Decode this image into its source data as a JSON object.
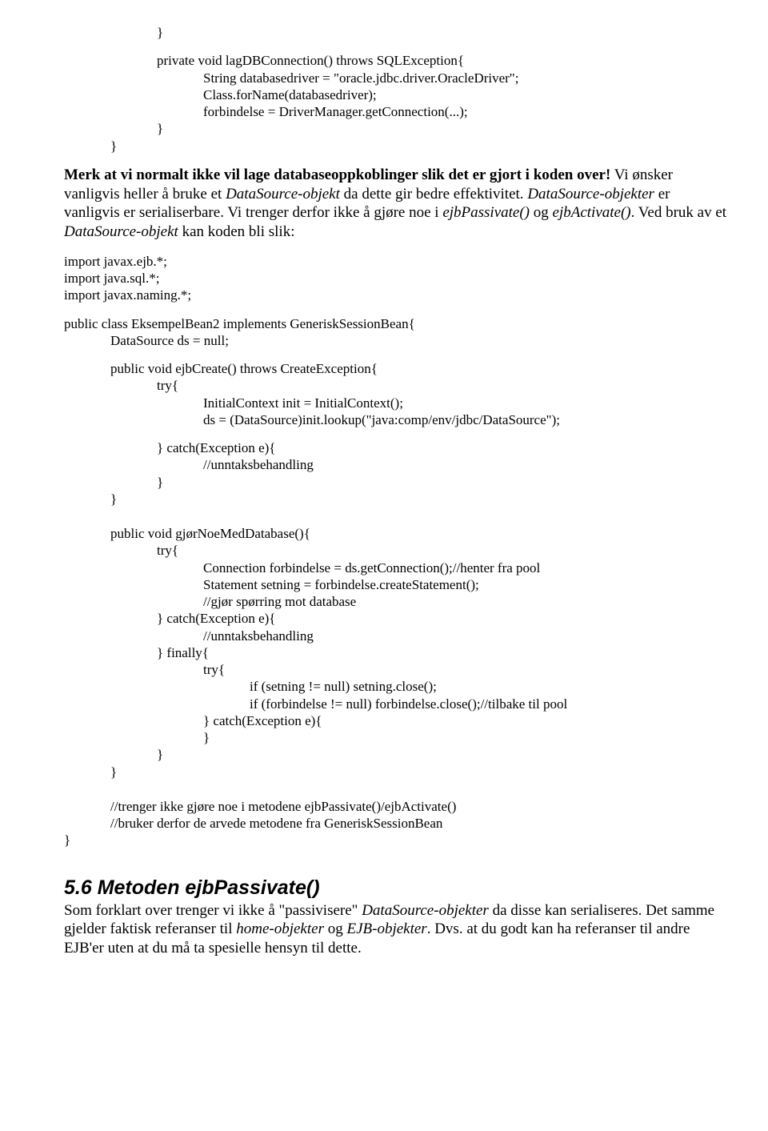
{
  "block1": {
    "l1": "}",
    "l2": "private void lagDBConnection() throws SQLException{",
    "l3": "String databasedriver = \"oracle.jdbc.driver.OracleDriver\";",
    "l4": "Class.forName(databasedriver);",
    "l5": "forbindelse = DriverManager.getConnection(...);",
    "l6": "}",
    "l7": "}"
  },
  "para1": {
    "t1": "Merk at vi normalt ikke vil lage databaseoppkoblinger slik det er gjort i koden over!",
    "t2": " Vi ønsker vanligvis heller å bruke et ",
    "t3": "DataSource-objekt",
    "t4": " da dette gir bedre effektivitet. ",
    "t5": "DataSource-objekter",
    "t6": " er vanligvis er serialiserbare. Vi trenger derfor ikke å gjøre noe i ",
    "t7": "ejbPassivate()",
    "t8": " og ",
    "t9": "ejbActivate()",
    "t10": ". Ved bruk av et ",
    "t11": "DataSource-objekt",
    "t12": " kan koden bli slik:"
  },
  "block2": {
    "l1": "import javax.ejb.*;",
    "l2": "import java.sql.*;",
    "l3": "import javax.naming.*;",
    "l4": "public class EksempelBean2 implements GeneriskSessionBean{",
    "l5": "DataSource ds = null;",
    "l6": "public void ejbCreate() throws CreateException{",
    "l7": "try{",
    "l8": "InitialContext init = InitialContext();",
    "l9": "ds = (DataSource)init.lookup(\"java:comp/env/jdbc/DataSource\");",
    "l10": "} catch(Exception e){",
    "l11": "//unntaksbehandling",
    "l12": "}",
    "l13": "}",
    "l14": "public void gjørNoeMedDatabase(){",
    "l15": "try{",
    "l16": "Connection forbindelse = ds.getConnection();//henter fra pool",
    "l17": "Statement setning = forbindelse.createStatement();",
    "l18": "//gjør spørring mot database",
    "l19": "} catch(Exception e){",
    "l20": "//unntaksbehandling",
    "l21": "} finally{",
    "l22": "try{",
    "l23": "if (setning != null) setning.close();",
    "l24": "if (forbindelse != null) forbindelse.close();//tilbake til pool",
    "l25": "} catch(Exception e){",
    "l26": "}",
    "l27": "}",
    "l28": "}",
    "l29": "//trenger ikke gjøre noe i metodene ejbPassivate()/ejbActivate()",
    "l30": "//bruker derfor de arvede metodene fra GeneriskSessionBean",
    "l31": "}"
  },
  "heading": "5.6 Metoden ejbPassivate()",
  "para2": {
    "t1": "Som forklart over trenger vi ikke å \"passivisere\" ",
    "t2": "DataSource-objekter",
    "t3": " da disse kan serialiseres. Det samme gjelder faktisk referanser til ",
    "t4": "home-objekter",
    "t5": " og ",
    "t6": "EJB-objekter",
    "t7": ". Dvs. at du godt kan ha referanser til andre EJB'er uten at du må ta spesielle hensyn til dette."
  }
}
